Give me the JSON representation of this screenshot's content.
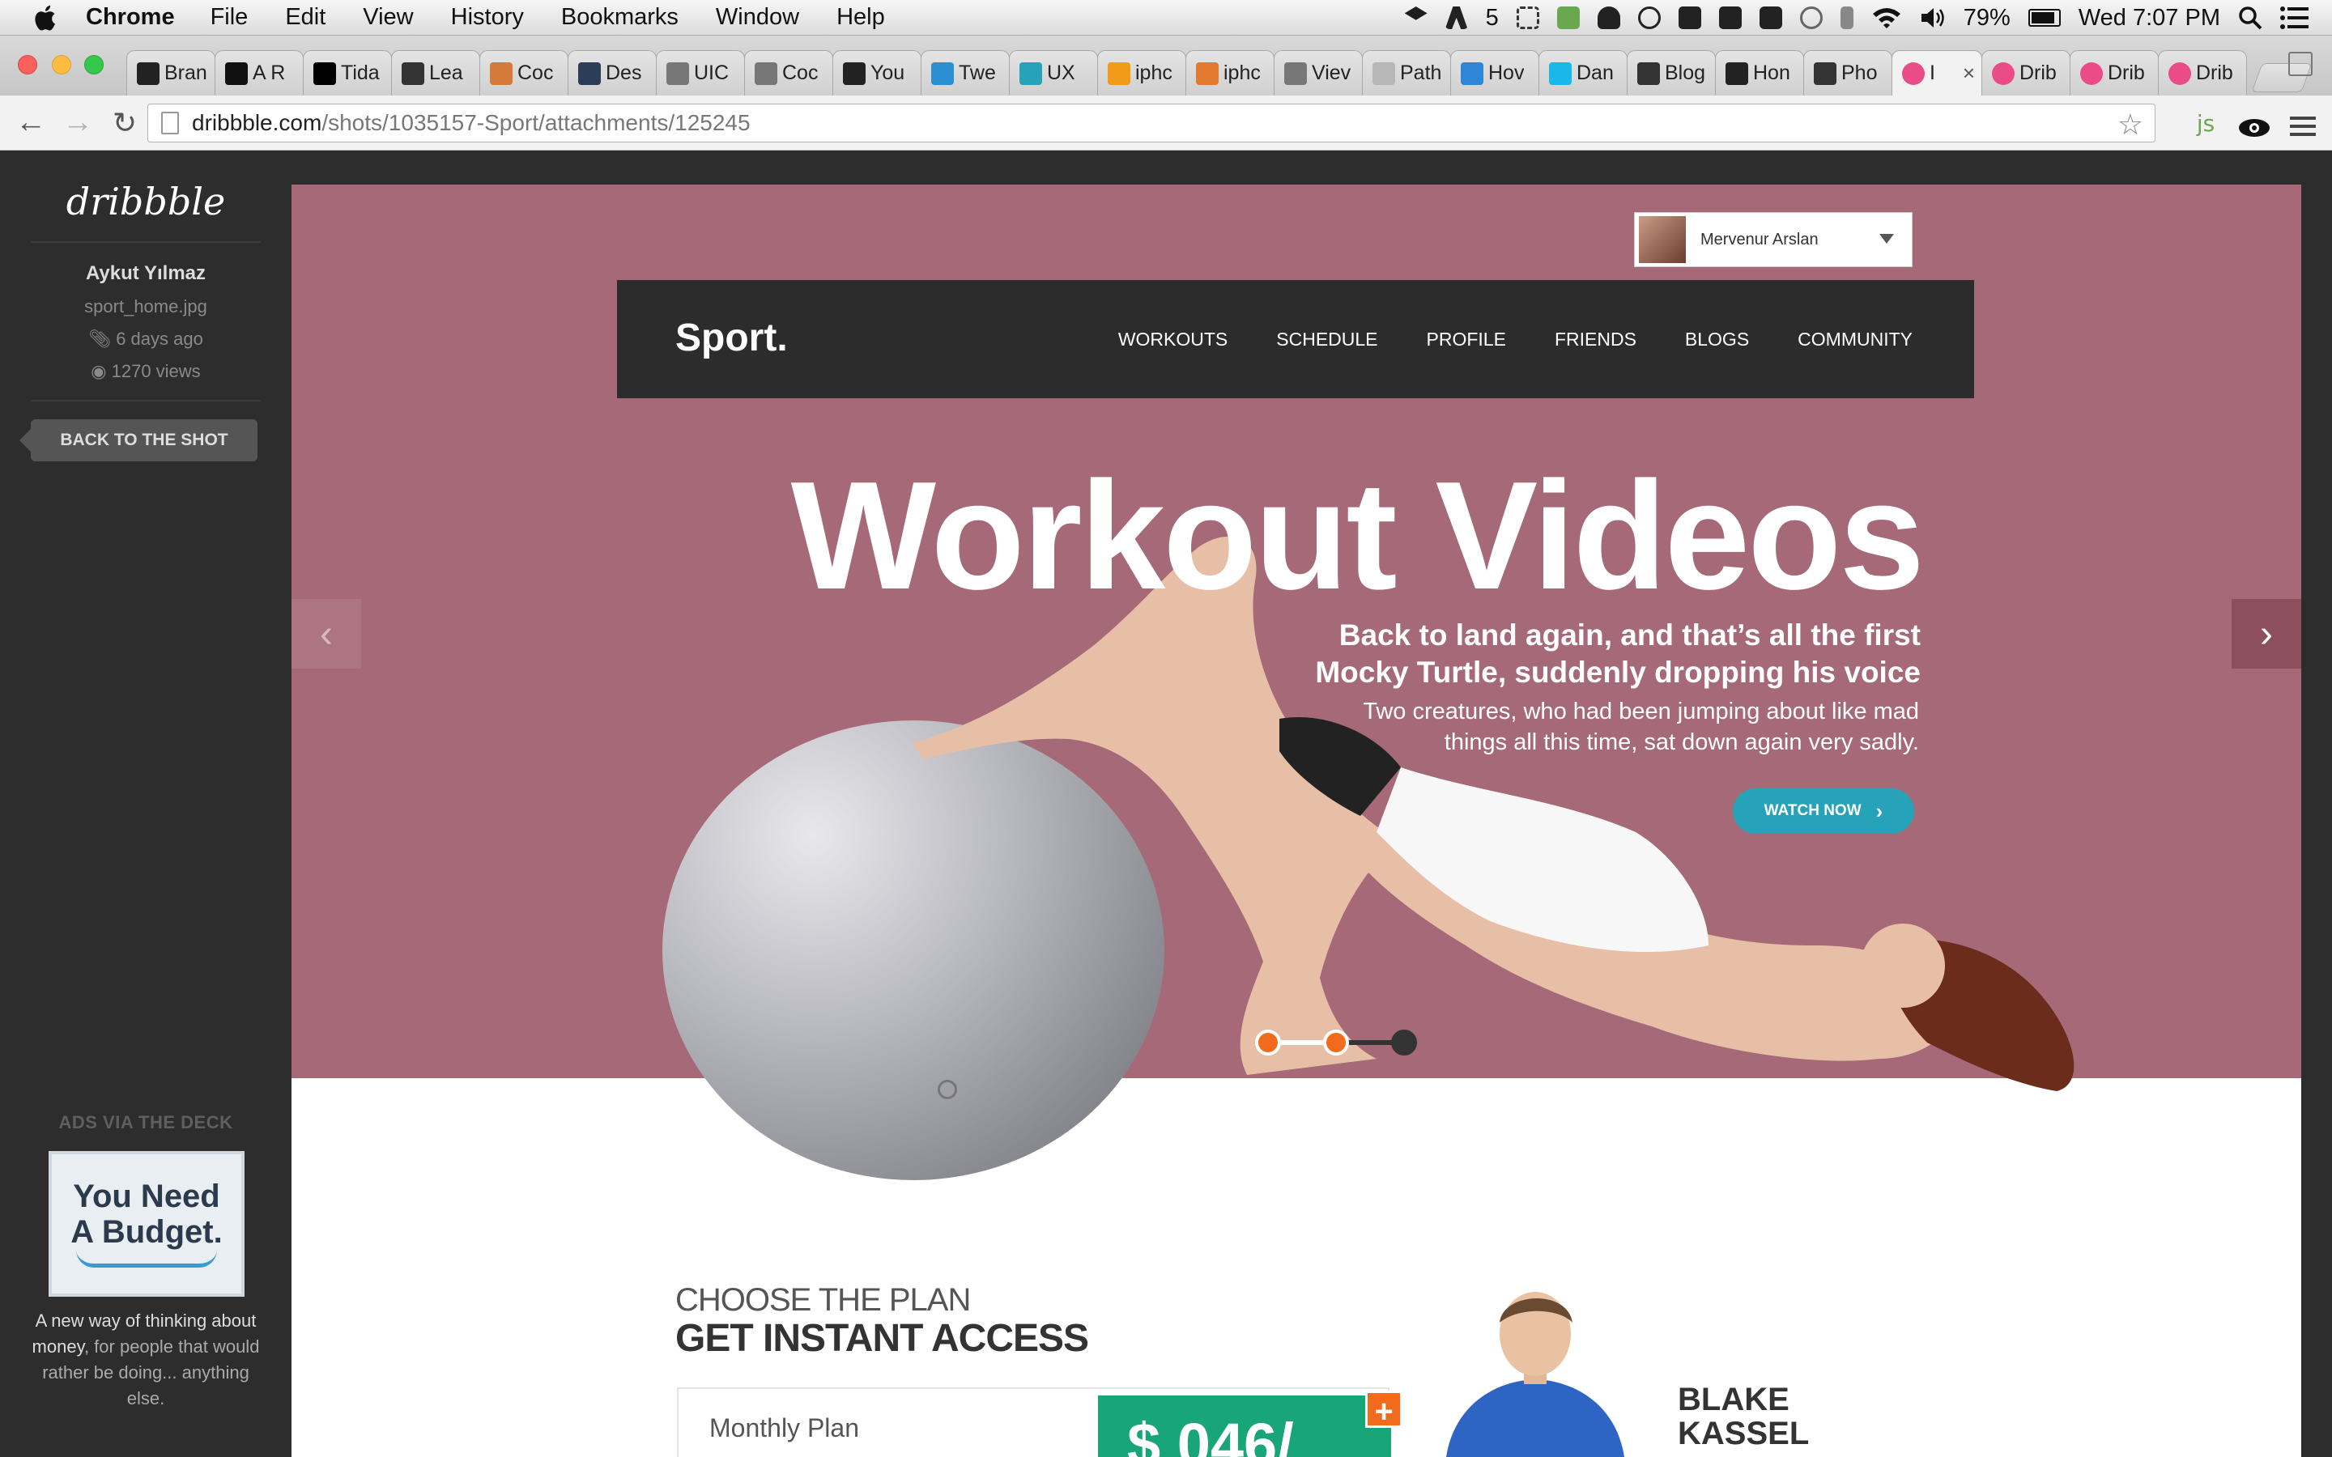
{
  "menubar": {
    "app_name": "Chrome",
    "items": [
      "File",
      "Edit",
      "View",
      "History",
      "Bookmarks",
      "Window",
      "Help"
    ],
    "status": {
      "adobe_count": "5",
      "battery": "79%",
      "clock": "Wed 7:07 PM"
    },
    "icons": [
      "apple-icon",
      "dropbox-icon",
      "adobe-icon",
      "screenshot-icon",
      "evernote-icon",
      "cloud-icon",
      "sync-icon",
      "box-icon",
      "elephant-icon",
      "check-icon",
      "time-machine-icon",
      "bluetooth-icon",
      "wifi-icon",
      "volume-icon",
      "battery-icon",
      "spotlight-icon",
      "notification-center-icon"
    ]
  },
  "tabs": [
    {
      "title": "Bran",
      "favicon_color": "#222222"
    },
    {
      "title": "A R",
      "favicon_color": "#111111"
    },
    {
      "title": "Tida",
      "favicon_color": "#000000"
    },
    {
      "title": "Lea",
      "favicon_color": "#333333"
    },
    {
      "title": "Coc",
      "favicon_color": "#d57a3a"
    },
    {
      "title": "Des",
      "favicon_color": "#2c3e57"
    },
    {
      "title": "UIC",
      "favicon_color": "#777777"
    },
    {
      "title": "Coc",
      "favicon_color": "#777777"
    },
    {
      "title": "You",
      "favicon_color": "#222222"
    },
    {
      "title": "Twe",
      "favicon_color": "#2b8fd1"
    },
    {
      "title": "UX",
      "favicon_color": "#26a3b8"
    },
    {
      "title": "iphc",
      "favicon_color": "#f29a1a"
    },
    {
      "title": "iphc",
      "favicon_color": "#e27a30"
    },
    {
      "title": "Viev",
      "favicon_color": "#777777"
    },
    {
      "title": "Path",
      "favicon_color": "#b7b7b7"
    },
    {
      "title": "Hov",
      "favicon_color": "#2f86d6"
    },
    {
      "title": "Dan",
      "favicon_color": "#1ab7ea"
    },
    {
      "title": "Blog",
      "favicon_color": "#333333"
    },
    {
      "title": "Hon",
      "favicon_color": "#222222"
    },
    {
      "title": "Pho",
      "favicon_color": "#333333"
    },
    {
      "title": "I",
      "favicon_color": "#ea4c89",
      "active": true
    },
    {
      "title": "Drib",
      "favicon_color": "#ea4c89"
    },
    {
      "title": "Drib",
      "favicon_color": "#ea4c89"
    },
    {
      "title": "Drib",
      "favicon_color": "#ea4c89"
    }
  ],
  "tab_close_glyph": "×",
  "address_bar": {
    "host": "dribbble.com",
    "path": "/shots/1035157-Sport/attachments/125245"
  },
  "sidebar": {
    "logo": "dribbble",
    "author": "Aykut Yılmaz",
    "filename": "sport_home.jpg",
    "age": "6 days ago",
    "views": "1270 views",
    "back_button": "BACK TO THE SHOT",
    "ads_title": "ADS VIA THE DECK",
    "ad_image_line1": "You Need",
    "ad_image_line2": "A Budget.",
    "ad_text_1": "A new way of thinking about",
    "ad_text_2": "money",
    "ad_text_3": ", for people that would rather be doing... anything else."
  },
  "shot": {
    "user_name": "Mervenur Arslan",
    "brand": "Sport.",
    "nav": [
      "WORKOUTS",
      "SCHEDULE",
      "PROFILE",
      "FRIENDS",
      "BLOGS",
      "COMMUNITY"
    ],
    "hero_title": "Workout Videos",
    "hero_sub_1": "Back to land again, and that’s all the first",
    "hero_sub_2": "Mocky Turtle, suddenly dropping his voice",
    "hero_body_1": "Two creatures, who had been jumping about like mad",
    "hero_body_2": "things all this time, sat down again very sadly.",
    "watch_button": "WATCH NOW",
    "slider_active_index": 3,
    "slider_total": 3,
    "plan_kicker": "CHOOSE THE PLAN",
    "plan_title": "GET INSTANT ACCESS",
    "plan_label": "Monthly Plan",
    "plan_price": "$ 046/",
    "plan_plus": "+",
    "trainer_first": "BLAKE",
    "trainer_last": "KASSEL",
    "colors": {
      "hero_bg": "#a66978",
      "nav_bg": "#2c2c2c",
      "watch_button": "#26a3b8",
      "price_bg": "#18a679",
      "plus_bg": "#f26b1d",
      "slider_active": "#f26b1d"
    }
  }
}
